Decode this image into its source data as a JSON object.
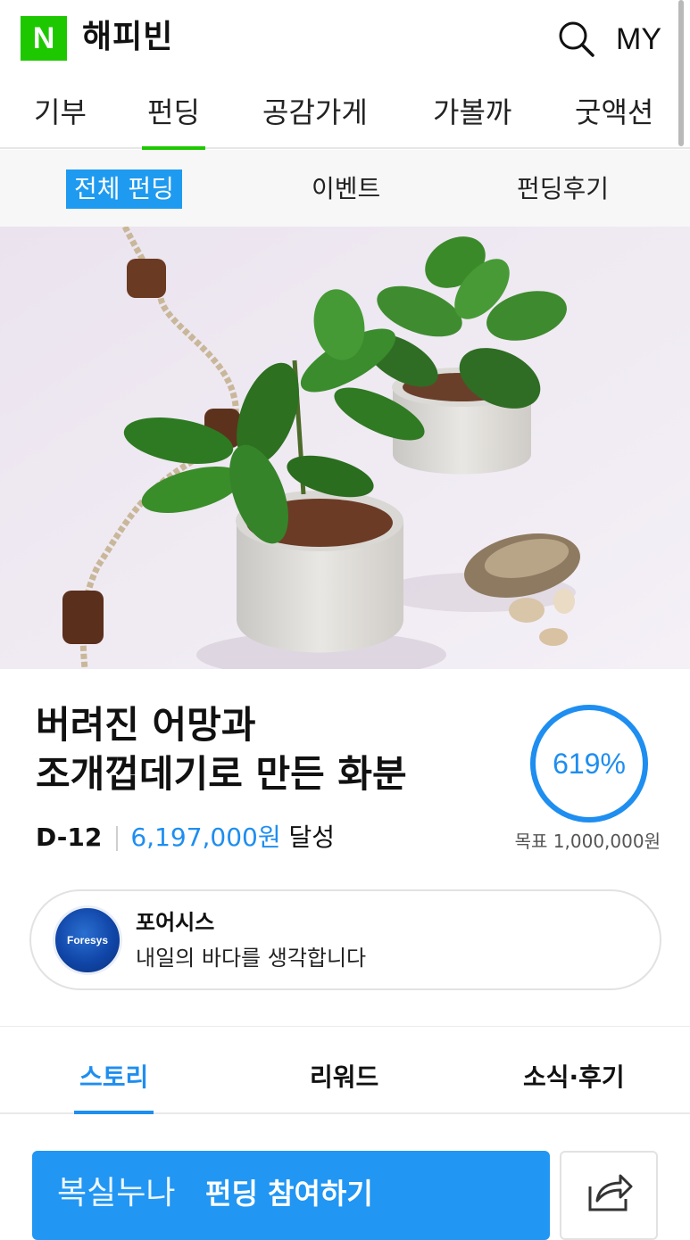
{
  "header": {
    "logo_letter": "N",
    "app_title": "해피빈",
    "search_icon": "search-icon",
    "my_label": "MY"
  },
  "main_nav": {
    "tabs": [
      {
        "label": "기부",
        "active": false
      },
      {
        "label": "펀딩",
        "active": true
      },
      {
        "label": "공감가게",
        "active": false
      },
      {
        "label": "가볼까",
        "active": false
      },
      {
        "label": "굿액션",
        "active": false
      }
    ]
  },
  "sub_nav": {
    "tabs": [
      {
        "label": "전체 펀딩",
        "active": true
      },
      {
        "label": "이벤트",
        "active": false
      },
      {
        "label": "펀딩후기",
        "active": false
      }
    ]
  },
  "project": {
    "title_line1": "버려진 어망과",
    "title_line2": "조개껍데기로 만든 화분",
    "dday": "D-12",
    "amount": "6,197,000원",
    "achieved_suffix": "달성",
    "progress_percent": 619,
    "progress_label": "619%",
    "goal_label": "목표 1,000,000원"
  },
  "organization": {
    "logo_text": "Foresys",
    "name": "포어시스",
    "description": "내일의 바다를 생각합니다"
  },
  "content_tabs": {
    "tabs": [
      {
        "label": "스토리",
        "active": true
      },
      {
        "label": "리워드",
        "active": false
      },
      {
        "label": "소식·후기",
        "active": false
      }
    ]
  },
  "action_bar": {
    "nickname": "복실누나",
    "fund_label": "펀딩 참여하기",
    "share_icon": "share-icon"
  },
  "colors": {
    "brand_green": "#1ec800",
    "accent_blue": "#1e8ef0",
    "button_blue": "#2196f3"
  }
}
